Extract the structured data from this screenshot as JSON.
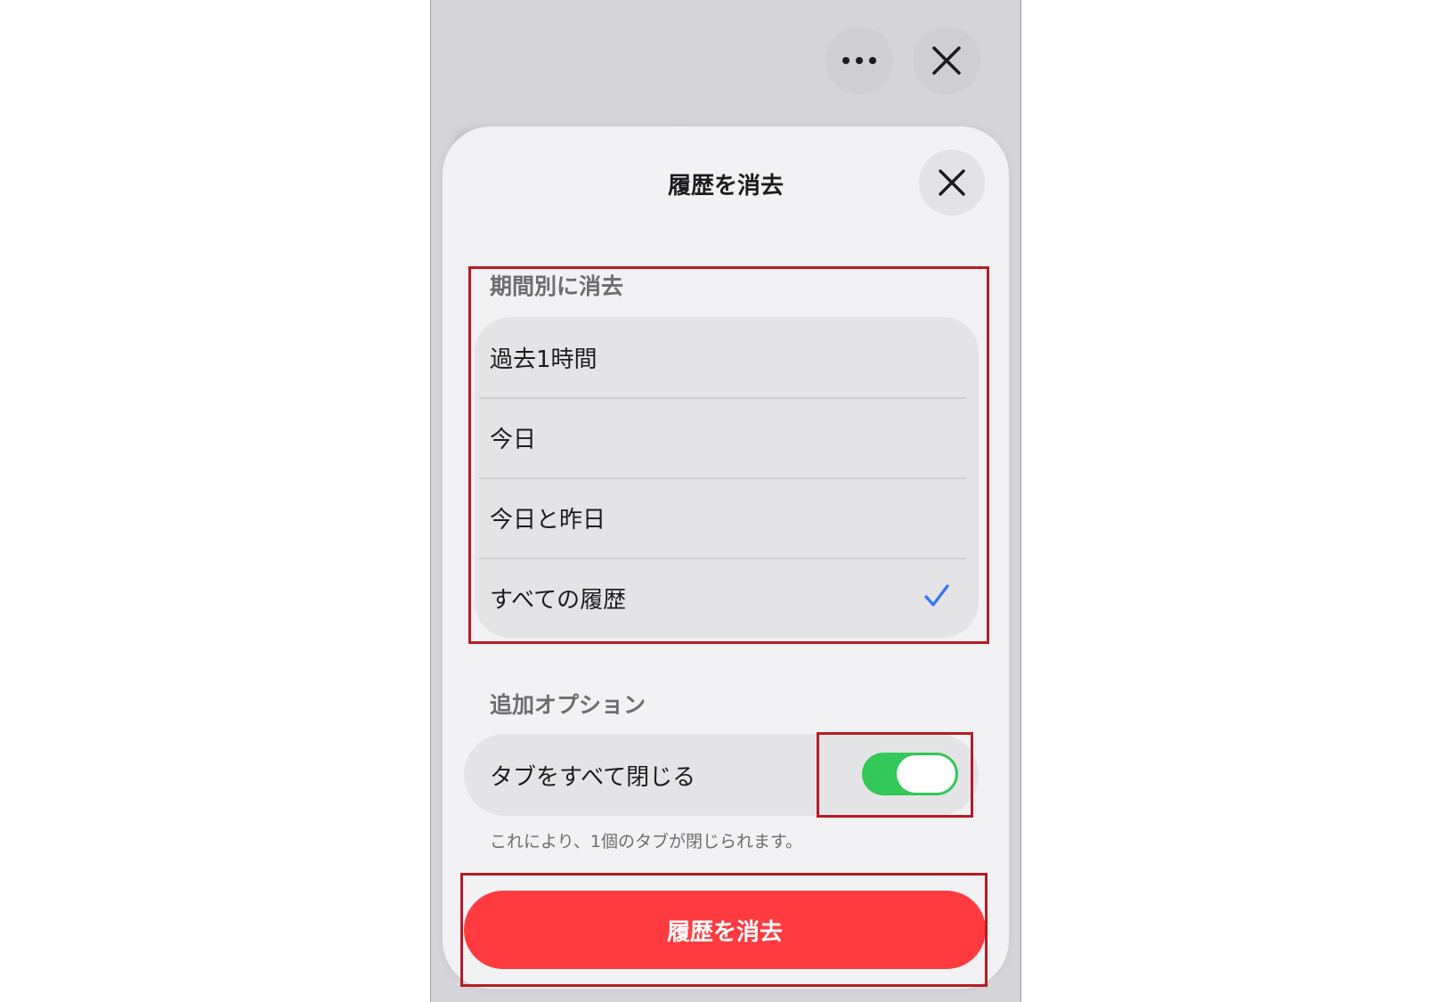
{
  "sheet": {
    "title": "履歴を消去",
    "close_icon": "close-icon"
  },
  "top_bar": {
    "more_icon": "more-icon",
    "close_icon": "close-icon"
  },
  "time_range": {
    "label": "期間別に消去",
    "options": [
      {
        "label": "過去1時間",
        "selected": false
      },
      {
        "label": "今日",
        "selected": false
      },
      {
        "label": "今日と昨日",
        "selected": false
      },
      {
        "label": "すべての履歴",
        "selected": true
      }
    ]
  },
  "additional": {
    "label": "追加オプション",
    "close_tabs_label": "タブをすべて閉じる",
    "close_tabs_on": true,
    "footnote": "これにより、1個のタブが閉じられます。"
  },
  "clear_button_label": "履歴を消去",
  "colors": {
    "accent": "#3478f6",
    "toggle_on": "#34c759",
    "destructive": "#ff3b40",
    "highlight_box": "#b81c22"
  }
}
